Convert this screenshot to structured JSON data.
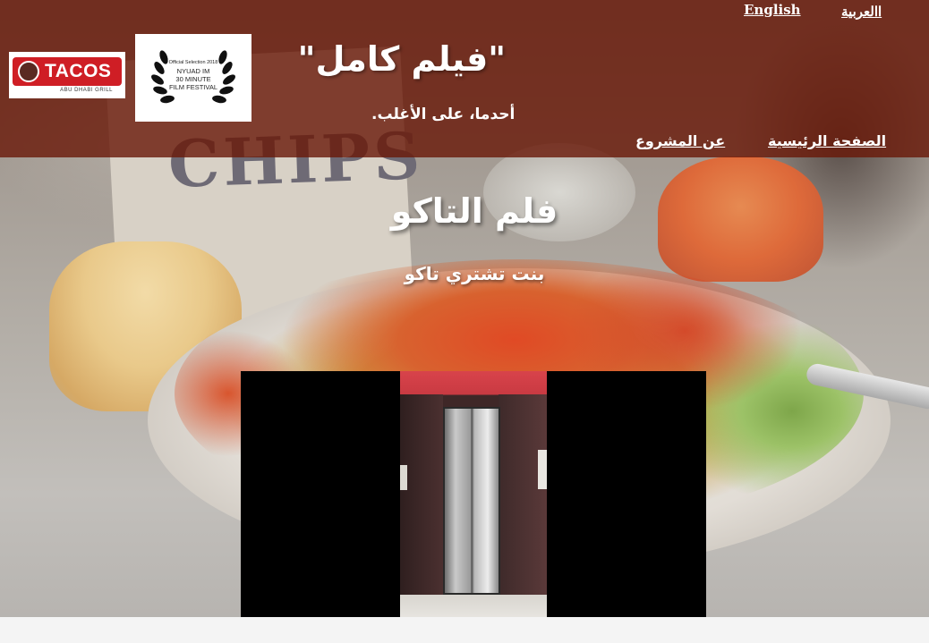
{
  "header": {
    "lang_links": {
      "english": "English",
      "arabic": "االعربية"
    },
    "logos": {
      "tacos": {
        "word": "TACOS",
        "sub": "ABU DHABI GRILL"
      },
      "festival": {
        "line1": "Official Selection 2018",
        "line2": "NYUAD IM",
        "line3": "30 MINUTE",
        "line4": "FILM FESTIVAL"
      }
    },
    "title": "\"فيلم كامل\"",
    "subtitle": "أحدما، على الأغلب.",
    "nav": {
      "home": "الصفحة الرئيسية",
      "about": "عن المشروع"
    }
  },
  "hero": {
    "title": "فلم التاكو",
    "subtitle": "بنت تشتري تاكو",
    "background_icon": "food-photo",
    "background_text": "CHIPS"
  },
  "colors": {
    "header_overlay": "#691808",
    "tacos_red": "#cf1e25",
    "text": "#ffffff"
  }
}
